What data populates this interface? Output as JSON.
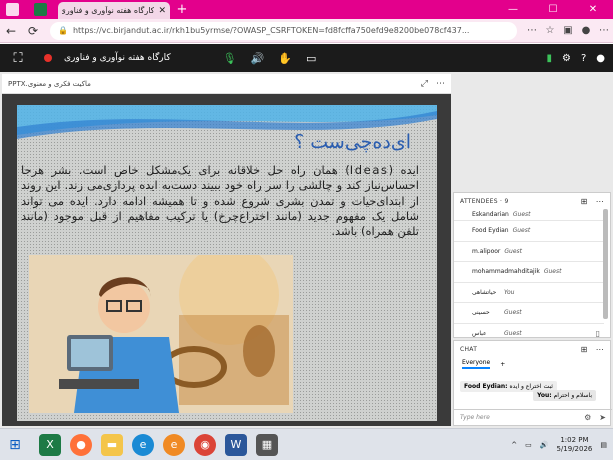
{
  "browser": {
    "tab_title": "کارگاه هفته نوآوری و فناوری",
    "new_tab": "+",
    "min": "—",
    "max": "☐",
    "close": "✕",
    "url": "https://vc.birjandut.ac.ir/rkh1bu5yrmse/?OWASP_CSRFTOKEN=fd8fcffa750efd9e8200be078cf437..."
  },
  "app": {
    "room_title": "کارگاه هفته نوآوری و فناوری"
  },
  "document": {
    "file_name": "ماکیت فکری و معنوی.PPTX",
    "slide_title": "ای‌ده‌چی‌ست ؟",
    "slide_body": "ایده (Ideas) همان راه حل خلاقانه برای یک‌مشکل خاص است. بشر هرجا احساس‌نیاز کند و چالشی را سر راه خود ببیند دست‌به ایده پردازی‌می زند. این روند از ابتدای‌حیات و تمدن بشری شروع شده و تا همیشه ادامه دارد. ایده می تواند شامل یک مفهوم جدید (مانند اختراع‌چرخ) یا ترکیب مفاهیم از قبل موجود (مانند تلفن همراه) باشد."
  },
  "attendees": {
    "header": "ATTENDEES · 9",
    "list": [
      {
        "name": "Eskandarian",
        "role": "Guest"
      },
      {
        "name": "Food Eydian",
        "role": "Guest"
      },
      {
        "name": "m.alipoor",
        "role": "Guest"
      },
      {
        "name": "mohammadmahditajik",
        "role": "Guest"
      },
      {
        "name": "حیاتشاهی",
        "role": "You"
      },
      {
        "name": "حسینی",
        "role": "Guest"
      },
      {
        "name": "عباس",
        "role": "Guest"
      }
    ]
  },
  "chat": {
    "header": "CHAT",
    "tab_everyone": "Everyone",
    "add": "+",
    "msg1_sender": "Food Eydian:",
    "msg1_text": "ثبت اختراع و ایده",
    "msg2_sender": "You:",
    "msg2_text": "باسلام و احترام",
    "input_placeholder": "Type here"
  },
  "taskbar": {
    "time": "1:02 PM",
    "date": "5/19/2026"
  }
}
